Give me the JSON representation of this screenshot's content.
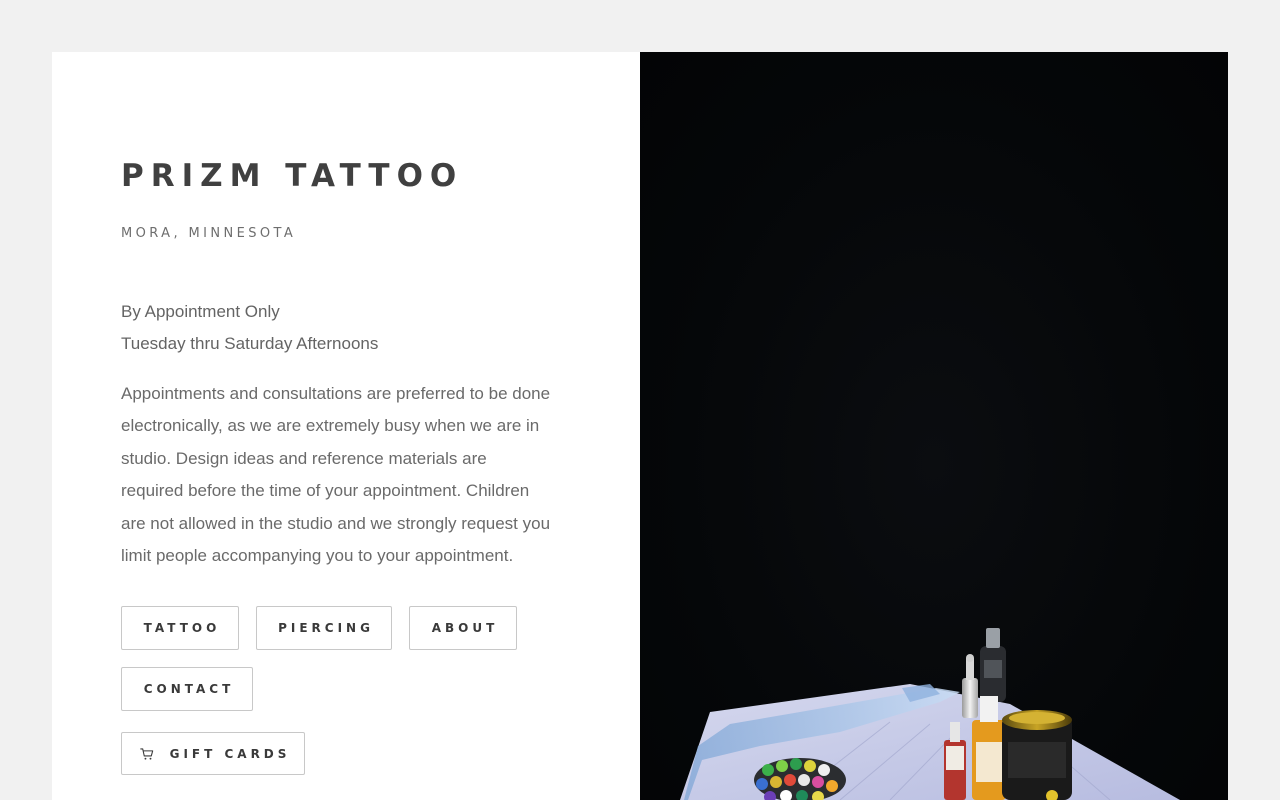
{
  "site": {
    "title": "PRIZM TATTOO",
    "subtitle": "MORA, MINNESOTA"
  },
  "hours": {
    "line1": "By Appointment Only",
    "line2": "Tuesday thru Saturday Afternoons"
  },
  "description": "Appointments and consultations are preferred to be done electronically, as we are extremely busy when we are in studio. Design ideas and reference materials are required before the time of your appointment. Children are not allowed in the studio and we strongly request you limit people accompanying you to your appointment.",
  "nav": {
    "tattoo": "TATTOO",
    "piercing": "PIERCING",
    "about": "ABOUT",
    "contact": "CONTACT"
  },
  "gift": {
    "label": "GIFT CARDS",
    "icon": "shopping-cart-icon"
  },
  "hero_image": {
    "subject": "tattoo ink bottles and palette on a tray against a dark background"
  },
  "colors": {
    "page_background": "#f1f1f1",
    "panel_background": "#ffffff",
    "title_text": "#404040",
    "body_text": "#646464",
    "button_border": "#c8c8c8",
    "image_background": "#050709"
  }
}
